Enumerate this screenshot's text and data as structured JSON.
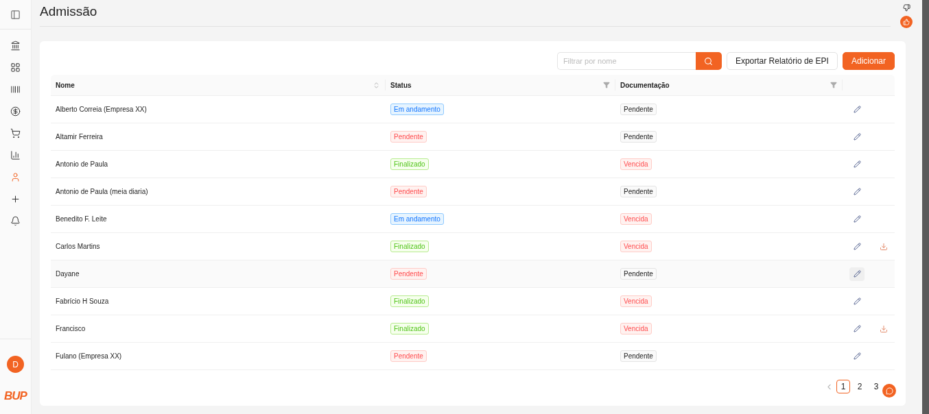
{
  "sidebar": {
    "items": [
      {
        "selected": false
      },
      {
        "selected": false
      },
      {
        "selected": false
      },
      {
        "selected": false
      },
      {
        "selected": false
      },
      {
        "selected": false
      },
      {
        "selected": true
      },
      {
        "selected": false
      },
      {
        "selected": false
      }
    ],
    "avatar": "D",
    "logo": "BUP"
  },
  "page": {
    "title": "Admissão"
  },
  "toolbar": {
    "search": {
      "placeholder": "Filtrar por nome"
    },
    "buttons": [
      {
        "kind": "secondary",
        "label": "Exportar Relatório de EPI"
      },
      {
        "kind": "primary",
        "label": "Adicionar"
      }
    ]
  },
  "table": {
    "columns": [
      {
        "label": "Nome",
        "sortable": true,
        "filterable": false
      },
      {
        "label": "Status",
        "sortable": false,
        "filterable": true
      },
      {
        "label": "Documentação",
        "sortable": false,
        "filterable": true
      }
    ],
    "rows": [
      {
        "name": "Alberto Correia (Empresa XX)",
        "status": {
          "label": "Em andamento",
          "kind": "info"
        },
        "documentation": {
          "label": "Pendente",
          "kind": "neutral"
        },
        "hovered": false,
        "download": false
      },
      {
        "name": "Altamir Ferreira",
        "status": {
          "label": "Pendente",
          "kind": "error"
        },
        "documentation": {
          "label": "Pendente",
          "kind": "neutral"
        },
        "hovered": false,
        "download": false
      },
      {
        "name": "Antonio de Paula",
        "status": {
          "label": "Finalizado",
          "kind": "success"
        },
        "documentation": {
          "label": "Vencida",
          "kind": "error"
        },
        "hovered": false,
        "download": false
      },
      {
        "name": "Antonio de Paula (meia diaria)",
        "status": {
          "label": "Pendente",
          "kind": "error"
        },
        "documentation": {
          "label": "Pendente",
          "kind": "neutral"
        },
        "hovered": false,
        "download": false
      },
      {
        "name": "Benedito F. Leite",
        "status": {
          "label": "Em andamento",
          "kind": "info"
        },
        "documentation": {
          "label": "Vencida",
          "kind": "error"
        },
        "hovered": false,
        "download": false
      },
      {
        "name": "Carlos Martins",
        "status": {
          "label": "Finalizado",
          "kind": "success"
        },
        "documentation": {
          "label": "Vencida",
          "kind": "error"
        },
        "hovered": false,
        "download": true
      },
      {
        "name": "Dayane",
        "status": {
          "label": "Pendente",
          "kind": "error"
        },
        "documentation": {
          "label": "Pendente",
          "kind": "neutral"
        },
        "hovered": true,
        "download": false
      },
      {
        "name": "Fabrício H Souza",
        "status": {
          "label": "Finalizado",
          "kind": "success"
        },
        "documentation": {
          "label": "Vencida",
          "kind": "error"
        },
        "hovered": false,
        "download": false
      },
      {
        "name": "Francisco",
        "status": {
          "label": "Finalizado",
          "kind": "success"
        },
        "documentation": {
          "label": "Vencida",
          "kind": "error"
        },
        "hovered": false,
        "download": true
      },
      {
        "name": "Fulano (Empresa XX)",
        "status": {
          "label": "Pendente",
          "kind": "error"
        },
        "documentation": {
          "label": "Pendente",
          "kind": "neutral"
        },
        "hovered": false,
        "download": false
      }
    ]
  },
  "pagination": {
    "pages": [
      {
        "label": "1",
        "selected": true
      },
      {
        "label": "2",
        "selected": false
      },
      {
        "label": "3",
        "selected": false
      }
    ]
  }
}
